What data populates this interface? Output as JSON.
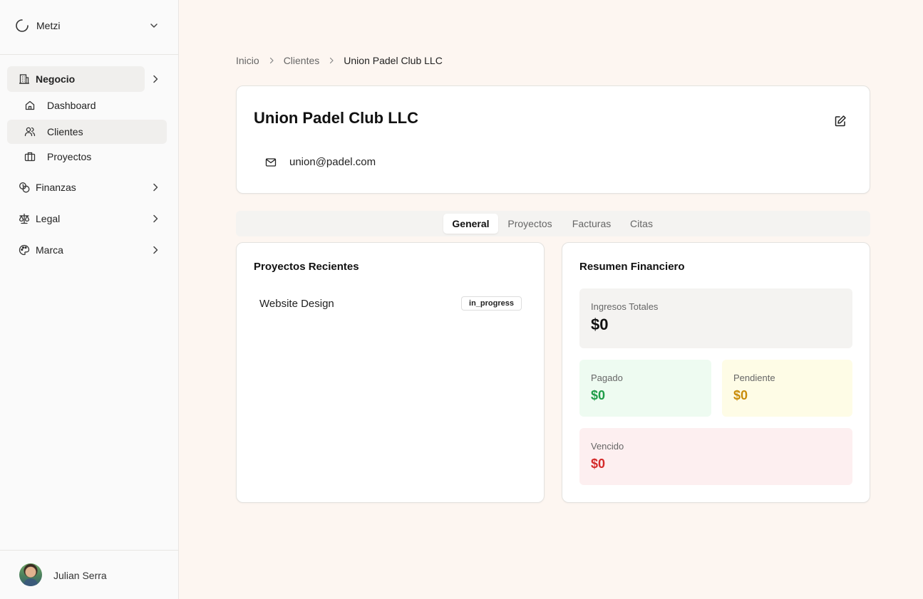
{
  "sidebar": {
    "workspace": {
      "name": "Metzi",
      "icon": "loader-circle-icon"
    },
    "groups": [
      {
        "label": "Negocio",
        "icon": "building-icon",
        "expanded": true,
        "items": [
          {
            "label": "Dashboard",
            "icon": "home-icon"
          },
          {
            "label": "Clientes",
            "icon": "users-icon",
            "active": true
          },
          {
            "label": "Proyectos",
            "icon": "briefcase-icon"
          }
        ]
      },
      {
        "label": "Finanzas",
        "icon": "coins-icon"
      },
      {
        "label": "Legal",
        "icon": "scale-icon"
      },
      {
        "label": "Marca",
        "icon": "palette-icon"
      }
    ],
    "user": {
      "name": "Julian Serra"
    }
  },
  "breadcrumb": [
    "Inicio",
    "Clientes",
    "Union Padel Club LLC"
  ],
  "client": {
    "name": "Union Padel Club LLC",
    "email": "union@padel.com"
  },
  "tabs": [
    {
      "label": "General",
      "active": true
    },
    {
      "label": "Proyectos"
    },
    {
      "label": "Facturas"
    },
    {
      "label": "Citas"
    }
  ],
  "recent_projects": {
    "title": "Proyectos Recientes",
    "items": [
      {
        "name": "Website Design",
        "status": "in_progress"
      }
    ]
  },
  "finance": {
    "title": "Resumen Financiero",
    "total": {
      "label": "Ingresos Totales",
      "value": "$0"
    },
    "paid": {
      "label": "Pagado",
      "value": "$0",
      "color": "#1f9d48"
    },
    "pending": {
      "label": "Pendiente",
      "value": "$0",
      "color": "#c98c0a"
    },
    "overdue": {
      "label": "Vencido",
      "value": "$0",
      "color": "#d42a2a"
    }
  }
}
